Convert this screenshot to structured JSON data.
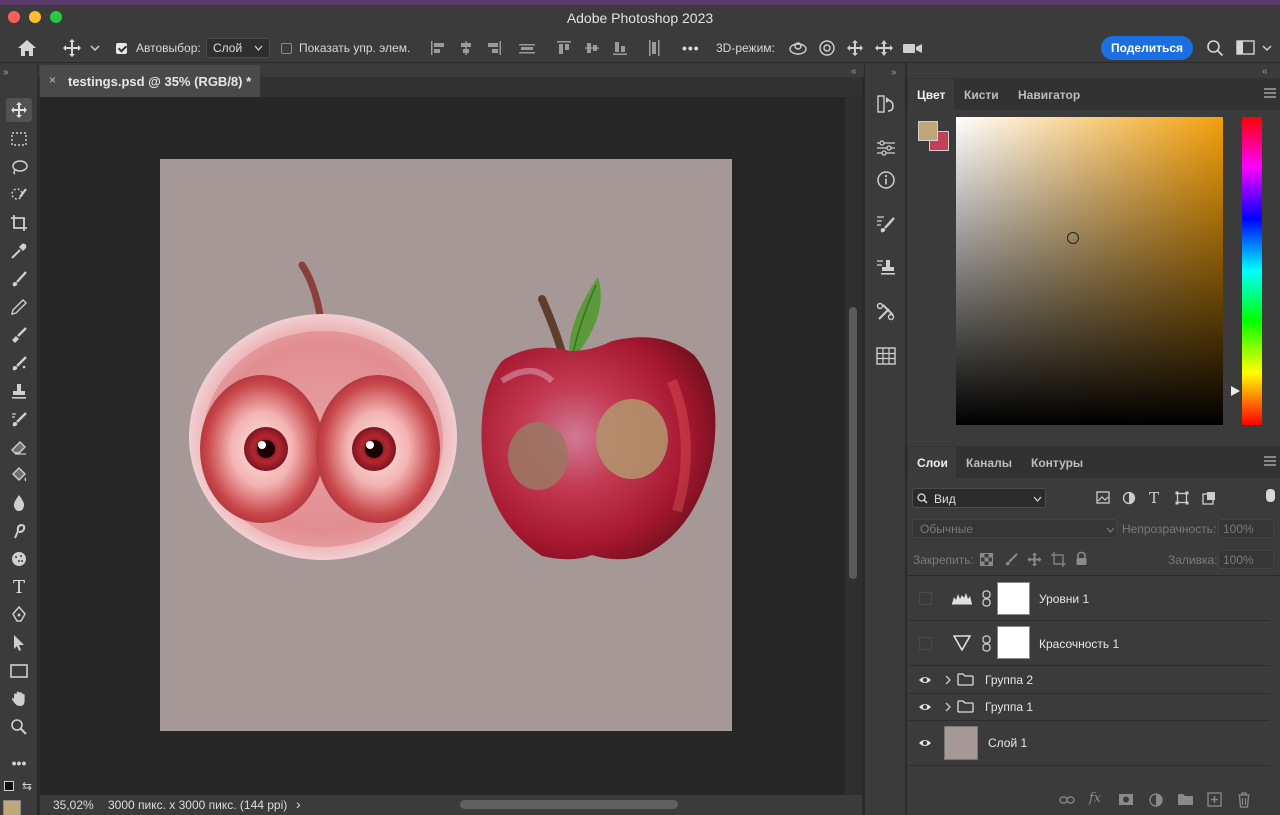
{
  "window": {
    "title": "Adobe Photoshop 2023"
  },
  "options_bar": {
    "autoselect_label": "Автовыбор:",
    "autoselect_value": "Слой",
    "show_controls_label": "Показать упр. элем.",
    "mode_3d_label": "3D-режим:",
    "share_label": "Поделиться",
    "more": "•••"
  },
  "document": {
    "tab_title": "testings.psd @ 35% (RGB/8) *",
    "canvas_bg": "#a79898"
  },
  "status": {
    "zoom": "35,02%",
    "size_info": "3000 пикс. x 3000 пикс. (144 ppi)",
    "arrow": "›"
  },
  "color_panel": {
    "tabs": [
      "Цвет",
      "Кисти",
      "Навигатор"
    ],
    "foreground": "#c0a77a",
    "background": "#c0405a"
  },
  "layers_panel": {
    "tabs": [
      "Слои",
      "Каналы",
      "Контуры"
    ],
    "filter_label": "Вид",
    "blend_mode": "Обычные",
    "opacity_label": "Непрозрачность:",
    "opacity_value": "100%",
    "lock_label": "Закрепить:",
    "fill_label": "Заливка:",
    "fill_value": "100%",
    "layers": [
      {
        "name": "Уровни 1",
        "kind": "levels-adjustment",
        "visible": false
      },
      {
        "name": "Красочность 1",
        "kind": "vibrance-adjustment",
        "visible": false
      },
      {
        "name": "Группа 2",
        "kind": "group",
        "visible": true
      },
      {
        "name": "Группа 1",
        "kind": "group",
        "visible": true
      },
      {
        "name": "Слой 1",
        "kind": "pixel",
        "visible": true
      }
    ]
  },
  "colors": {
    "accent": "#1b6fe0",
    "ui_bg": "#3b3b3b",
    "canvas_area": "#262626"
  }
}
